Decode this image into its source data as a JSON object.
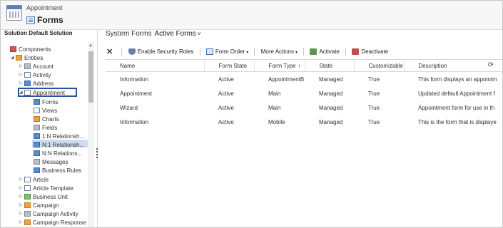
{
  "header": {
    "parent": "Appointment",
    "title": "Forms"
  },
  "sidebar": {
    "heading": "Solution Default Solution",
    "tree": [
      {
        "label": "Components"
      },
      {
        "label": "Entities"
      },
      {
        "label": "Account"
      },
      {
        "label": "Activity"
      },
      {
        "label": "Address"
      },
      {
        "label": "Appointment"
      },
      {
        "label": "Forms"
      },
      {
        "label": "Views"
      },
      {
        "label": "Charts"
      },
      {
        "label": "Fields"
      },
      {
        "label": "1:N Relationsh..."
      },
      {
        "label": "N:1 Relationsh..."
      },
      {
        "label": "N:N Relations..."
      },
      {
        "label": "Messages"
      },
      {
        "label": "Business Rules"
      },
      {
        "label": "Article"
      },
      {
        "label": "Article Template"
      },
      {
        "label": "Business Unit"
      },
      {
        "label": "Campaign"
      },
      {
        "label": "Campaign Activity"
      },
      {
        "label": "Campaign Response"
      }
    ]
  },
  "main": {
    "view_prefix": "System Forms",
    "view_name": "Active Forms",
    "toolbar": {
      "security": "Enable Security Roles",
      "form_order": "Form Order",
      "more_actions": "More Actions",
      "activate": "Activate",
      "deactivate": "Deactivate"
    },
    "columns": [
      "Name",
      "Form State",
      "Form Type",
      "State",
      "Customizable",
      "Description"
    ],
    "rows": [
      [
        "Information",
        "Active",
        "AppointmentB...",
        "Managed",
        "True",
        "This form displays an appointm"
      ],
      [
        "Appointment",
        "Active",
        "Main",
        "Managed",
        "True",
        "Updated default Appointment f"
      ],
      [
        "Wizard",
        "Active",
        "Main",
        "Managed",
        "True",
        "Appointment form for use in th"
      ],
      [
        "Information",
        "Active",
        "Mobile",
        "Managed",
        "True",
        "This is the form that is displaye"
      ]
    ]
  }
}
